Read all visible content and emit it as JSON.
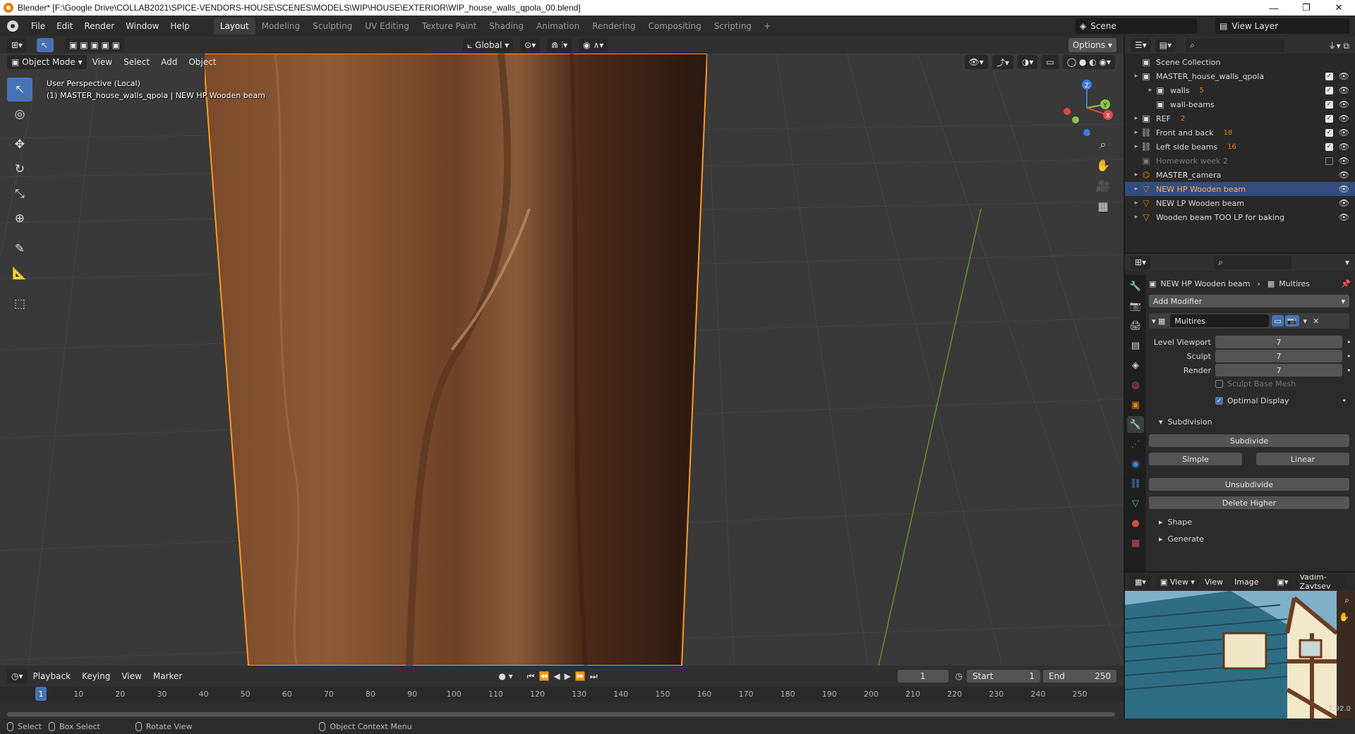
{
  "window": {
    "title": "Blender* [F:\\Google Drive\\COLLAB2021\\SPICE-VENDORS-HOUSE\\SCENES\\MODELS\\WIP\\HOUSE\\EXTERIOR\\WIP_house_walls_qpola_00.blend]",
    "minimize": "—",
    "maximize": "❐",
    "close": "✕"
  },
  "menu": [
    "File",
    "Edit",
    "Render",
    "Window",
    "Help"
  ],
  "workspaces": [
    "Layout",
    "Modeling",
    "Sculpting",
    "UV Editing",
    "Texture Paint",
    "Shading",
    "Animation",
    "Rendering",
    "Compositing",
    "Scripting"
  ],
  "workspace_active": "Layout",
  "scene": {
    "name": "Scene",
    "view_layer": "View Layer"
  },
  "viewport": {
    "transform_orientation": "Global",
    "options_label": "Options",
    "mode": "Object Mode",
    "menus": [
      "View",
      "Select",
      "Add",
      "Object"
    ],
    "perspective_text": "User Perspective (Local)",
    "object_text": "(1) MASTER_house_walls_qpola | NEW HP Wooden beam",
    "gizmo": {
      "z": "Z",
      "y": "Y",
      "x": "X"
    }
  },
  "timeline": {
    "menus": [
      "Playback",
      "Keying",
      "View",
      "Marker"
    ],
    "current_frame": "1",
    "start_label": "Start",
    "start": "1",
    "end_label": "End",
    "end": "250",
    "ticks": [
      "1",
      "10",
      "20",
      "30",
      "40",
      "50",
      "60",
      "70",
      "80",
      "90",
      "100",
      "110",
      "120",
      "130",
      "140",
      "150",
      "160",
      "170",
      "180",
      "190",
      "200",
      "210",
      "220",
      "230",
      "240",
      "250"
    ]
  },
  "statusbar": {
    "select": "Select",
    "box_select": "Box Select",
    "rotate": "Rotate View",
    "context": "Object Context Menu",
    "version": "2.92.0"
  },
  "outliner": {
    "root": "Scene Collection",
    "rows": [
      {
        "label": "MASTER_house_walls_qpola",
        "badge": "",
        "selected": false,
        "dim": false
      },
      {
        "label": "walls",
        "badge": "5",
        "selected": false,
        "dim": false
      },
      {
        "label": "wall-beams",
        "badge": "",
        "selected": false,
        "dim": false
      },
      {
        "label": "REF",
        "badge": "2",
        "selected": false,
        "dim": false
      },
      {
        "label": "Front and back",
        "badge": "18",
        "selected": false,
        "dim": false
      },
      {
        "label": "Left side beams",
        "badge": "16",
        "selected": false,
        "dim": false
      },
      {
        "label": "Homework week 2",
        "badge": "",
        "selected": false,
        "dim": true
      },
      {
        "label": "MASTER_camera",
        "badge": "",
        "selected": false,
        "dim": false
      },
      {
        "label": "NEW HP Wooden beam",
        "badge": "",
        "selected": true,
        "dim": false
      },
      {
        "label": "NEW LP Wooden beam",
        "badge": "",
        "selected": false,
        "dim": false
      },
      {
        "label": "Wooden beam TOO LP for baking",
        "badge": "",
        "selected": false,
        "dim": false
      }
    ]
  },
  "properties": {
    "object_name": "NEW HP Wooden beam",
    "modifier_type": "Multires",
    "add_modifier": "Add Modifier",
    "modifier_name": "Multires",
    "level_viewport_label": "Level Viewport",
    "level_viewport": "7",
    "sculpt_label": "Sculpt",
    "sculpt": "7",
    "render_label": "Render",
    "render": "7",
    "sculpt_base_mesh": "Sculpt Base Mesh",
    "optimal_display": "Optimal Display",
    "subdivision_label": "Subdivision",
    "subdivide": "Subdivide",
    "simple": "Simple",
    "linear": "Linear",
    "unsubdivide": "Unsubdivide",
    "delete_higher": "Delete Higher",
    "shape": "Shape",
    "generate": "Generate"
  },
  "image_editor": {
    "menus": [
      "View",
      "View",
      "Image"
    ],
    "image_name": "Vadim-Zaytsev"
  },
  "colors": {
    "accent": "#4772b3",
    "selection_outline": "#ff9a1f",
    "bg_viewport": "#393939",
    "orange": "#e87d0d"
  }
}
